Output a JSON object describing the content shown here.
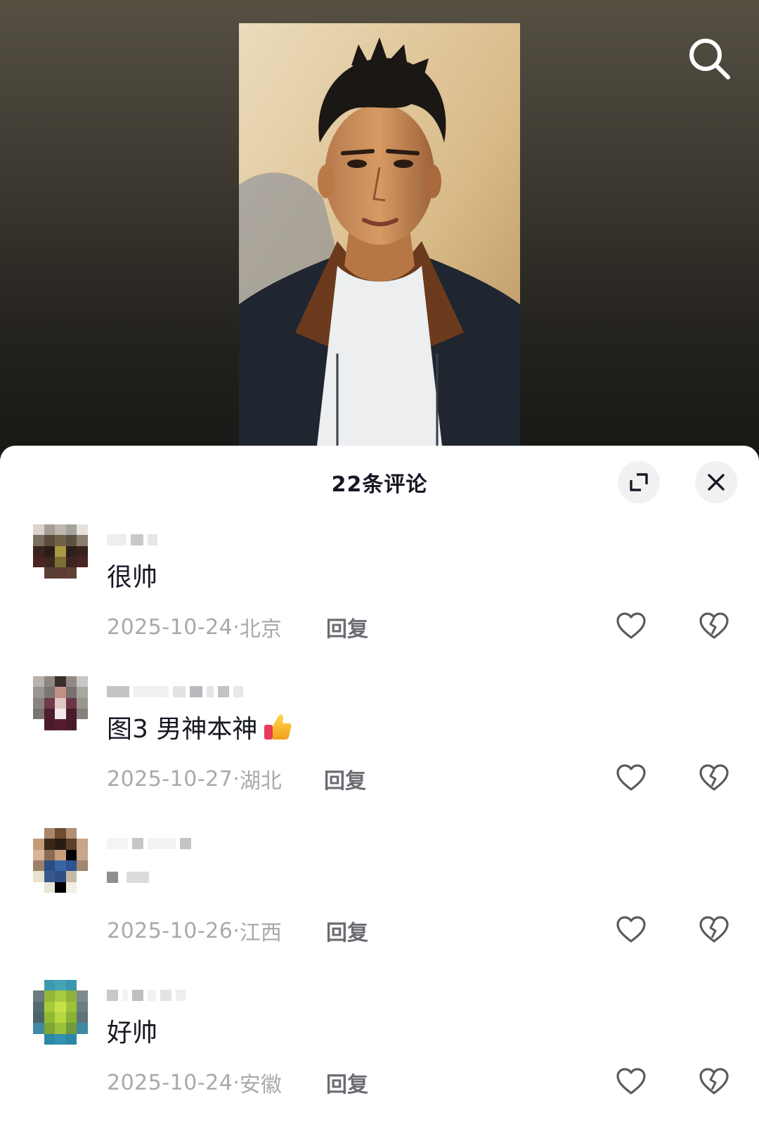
{
  "header": {
    "title": "22条评论"
  },
  "comments": [
    {
      "text": "很帅",
      "date": "2025-10-24",
      "location": "北京",
      "reply_label": "回复"
    },
    {
      "text": "图3 男神本神",
      "emoji": "thumbs-up-icon",
      "date": "2025-10-27",
      "location": "湖北",
      "reply_label": "回复"
    },
    {
      "text": "",
      "date": "2025-10-26",
      "location": "江西",
      "reply_label": "回复"
    },
    {
      "text": "好帅",
      "date": "2025-10-24",
      "location": "安徽",
      "reply_label": "回复"
    }
  ],
  "meta_separator": "· ",
  "colors": {
    "sheet_bg": "#ffffff",
    "title": "#161823",
    "meta": "#a8a9ad",
    "reply": "#6b6c72",
    "icon": "#5a5b61"
  }
}
